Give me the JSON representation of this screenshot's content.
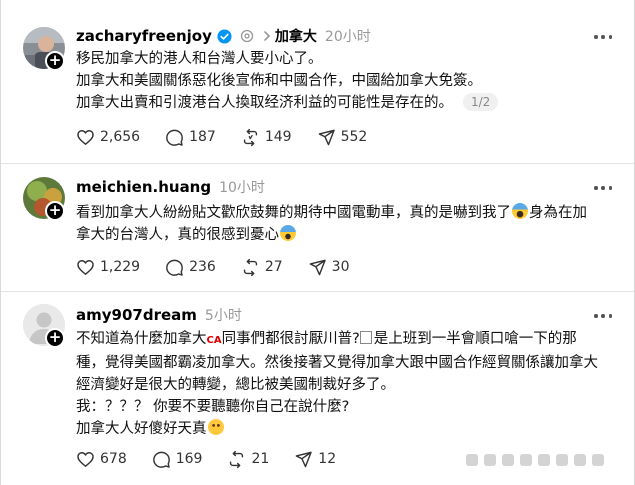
{
  "posts": [
    {
      "username": "zacharyfreenjoy",
      "verified": true,
      "community": "加拿大",
      "timestamp": "20小时",
      "lines": [
        "移民加拿大的港人和台灣人要小心了。",
        "加拿大和美國關係惡化後宣佈和中國合作，中國給加拿大免簽。",
        "加拿大出賣和引渡港台人換取经济利益的可能性是存在的。"
      ],
      "page_indicator": "1/2",
      "likes": "2,656",
      "replies": "187",
      "reposts": "149",
      "shares": "552",
      "avatar_icon": "profile-photo"
    },
    {
      "username": "meichien.huang",
      "timestamp": "10小时",
      "line1_prefix": "看到加拿大人紛紛貼文歡欣鼓舞的期待中國電動車，真的是嚇到我了",
      "line1_suffix": "身為在加",
      "line2_prefix": "拿大的台灣人，真的很感到憂心",
      "likes": "1,229",
      "replies": "236",
      "reposts": "27",
      "shares": "30",
      "emoji_1": "screaming-face-emoji",
      "emoji_2": "anxious-face-emoji"
    },
    {
      "username": "amy907dream",
      "timestamp": "5小时",
      "line1_a": "不知道為什麼加拿大",
      "line1_b": "同事們都很討厭川普?",
      "line1_c": "是上班到一半會順口嗆一下的那",
      "ca_mark": "CA",
      "line2": "種，覺得美國都霸凌加拿大。然後接著又覺得加拿大跟中國合作經貿關係讓加拿大",
      "line3": "經濟變好是很大的轉變，總比被美國制裁好多了。",
      "line4": "我：？？？ 你要不要聽聽你自己在說什麼?",
      "line5": "加拿大人好傻好天真",
      "likes": "678",
      "replies": "169",
      "reposts": "21",
      "shares": "12",
      "emoji": "smiling-face-emoji"
    }
  ],
  "colors": {
    "verified_blue": "#0095f6",
    "muted_gray": "#999999"
  }
}
